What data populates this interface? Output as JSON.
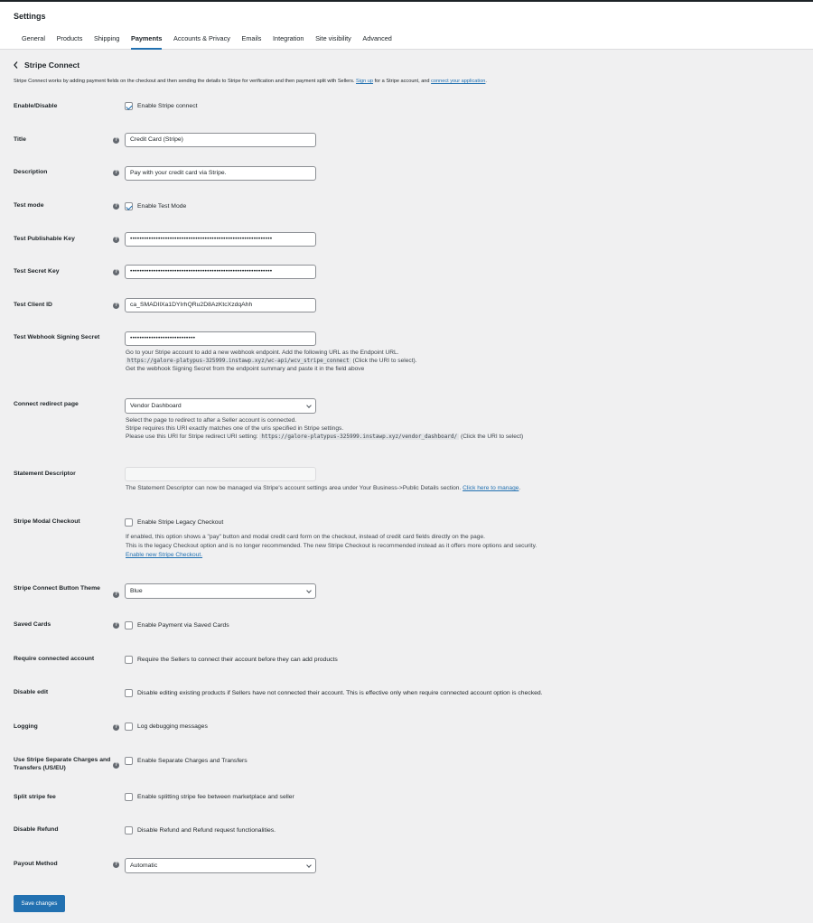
{
  "header": {
    "title": "Settings",
    "tabs": [
      "General",
      "Products",
      "Shipping",
      "Payments",
      "Accounts & Privacy",
      "Emails",
      "Integration",
      "Site visibility",
      "Advanced"
    ]
  },
  "section": {
    "title": "Stripe Connect",
    "intro_pre": "Stripe Connect works by adding payment fields on the checkout and then sending the details to Stripe for verification and then payment split with Sellers. ",
    "intro_link1": "Sign up",
    "intro_mid": " for a Stripe account, and ",
    "intro_link2": "connect your application",
    "intro_post": "."
  },
  "fields": {
    "enable": {
      "label": "Enable/Disable",
      "text": "Enable Stripe connect",
      "checked": true
    },
    "title": {
      "label": "Title",
      "value": "Credit Card (Stripe)"
    },
    "description": {
      "label": "Description",
      "value": "Pay with your credit card via Stripe."
    },
    "test_mode": {
      "label": "Test mode",
      "text": "Enable Test Mode",
      "checked": true
    },
    "pub_key": {
      "label": "Test Publishable Key",
      "value": "•••••••••••••••••••••••••••••••••••••••••••••••••••••••••••••"
    },
    "secret_key": {
      "label": "Test Secret Key",
      "value": "•••••••••••••••••••••••••••••••••••••••••••••••••••••••••••••"
    },
    "client_id": {
      "label": "Test Client ID",
      "value": "ca_SMADIlXa1DYIrhQRu2D8AzKtcXzdqAhh"
    },
    "webhook": {
      "label": "Test Webhook Signing Secret",
      "value": "••••••••••••••••••••••••••••",
      "desc1": "Go to your Stripe account to add a new webhook endpoint. Add the following URL as the Endpoint URL.",
      "code": "https://galore-platypus-325999.instawp.xyz/wc-api/wcv_stripe_connect",
      "desc2_suffix": " (Click the URI to select).",
      "desc3": "Get the webhook Signing Secret from the endpoint summary and paste it in the field above"
    },
    "redirect": {
      "label": "Connect redirect page",
      "value": "Vendor Dashboard",
      "desc1": "Select the page to redirect to after a Seller account is connected.",
      "desc2": "Stripe requires this URI exactly matches one of the uris specified in Stripe settings.",
      "desc3_prefix": "Please use this URI for Stripe redirect URI setting: ",
      "code": "https://galore-platypus-325999.instawp.xyz/vendor_dashboard/",
      "desc3_suffix": " (Click the URI to select)"
    },
    "statement": {
      "label": "Statement Descriptor",
      "desc_pre": "The Statement Descriptor can now be managed via Stripe's account settings area under Your Business->Public Details section. ",
      "desc_link": "Click here to manage",
      "desc_post": "."
    },
    "modal": {
      "label": "Stripe Modal Checkout",
      "text": "Enable Stripe Legacy Checkout",
      "checked": false,
      "desc1": "If enabled, this option shows a \"pay\" button and modal credit card form on the checkout, instead of credit card fields directly on the page.",
      "desc2": "This is the legacy Checkout option and is no longer recommended. The new Stripe Checkout is recommended instead as it offers more options and security.",
      "link": "Enable new Stripe Checkout."
    },
    "theme": {
      "label": "Stripe Connect Button Theme",
      "value": "Blue"
    },
    "saved": {
      "label": "Saved Cards",
      "text": "Enable Payment via Saved Cards",
      "checked": false
    },
    "require": {
      "label": "Require connected account",
      "text": "Require the Sellers to connect their account before they can add products",
      "checked": false
    },
    "disable_edit": {
      "label": "Disable edit",
      "text": "Disable editing existing products if Sellers have not connected their account. This is effective only when require connected account option is checked.",
      "checked": false
    },
    "logging": {
      "label": "Logging",
      "text": "Log debugging messages",
      "checked": false
    },
    "separate": {
      "label": "Use Stripe Separate Charges and Transfers (US/EU)",
      "text": "Enable Separate Charges and Transfers",
      "checked": false
    },
    "split": {
      "label": "Split stripe fee",
      "text": "Enable splitting stripe fee between marketplace and seller",
      "checked": false
    },
    "refund": {
      "label": "Disable Refund",
      "text": "Disable Refund and Refund request functionalities.",
      "checked": false
    },
    "payout": {
      "label": "Payout Method",
      "value": "Automatic"
    }
  },
  "save_button": "Save changes",
  "help_glyph": "?"
}
